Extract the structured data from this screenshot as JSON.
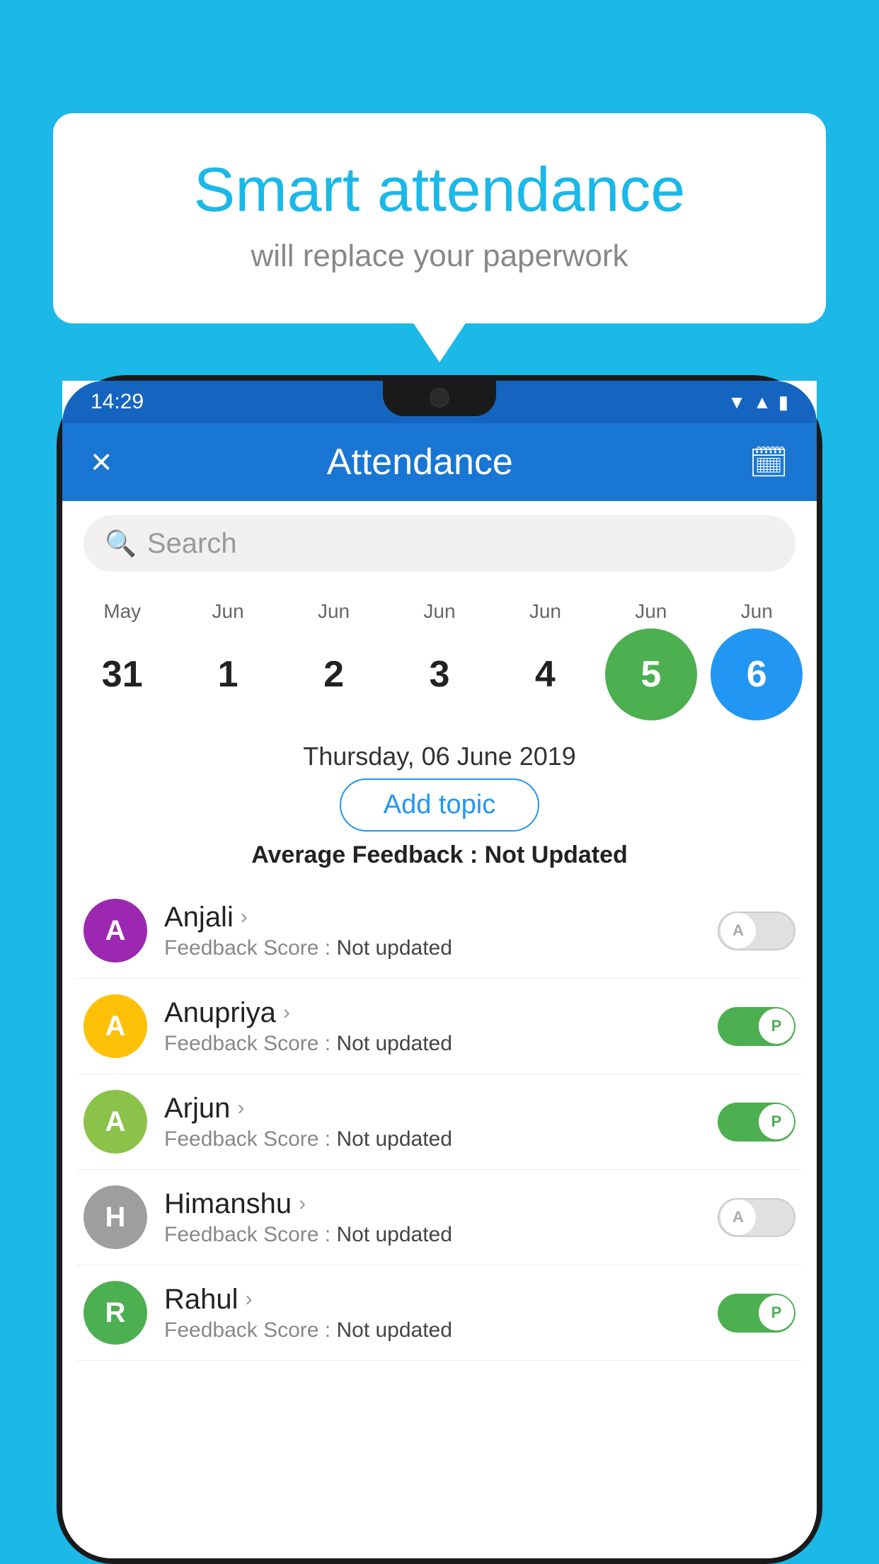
{
  "background_color": "#1BB8E8",
  "bubble": {
    "title": "Smart attendance",
    "subtitle": "will replace your paperwork"
  },
  "status_bar": {
    "time": "14:29",
    "wifi": "▼",
    "signal": "▲",
    "battery": "▪"
  },
  "app_bar": {
    "close_label": "×",
    "title": "Attendance",
    "calendar_icon": "📅"
  },
  "search": {
    "placeholder": "Search"
  },
  "calendar": {
    "months": [
      "May",
      "Jun",
      "Jun",
      "Jun",
      "Jun",
      "Jun",
      "Jun"
    ],
    "dates": [
      "31",
      "1",
      "2",
      "3",
      "4",
      "5",
      "6"
    ],
    "selected_green_index": 5,
    "selected_blue_index": 6
  },
  "selected_date": {
    "label": "Thursday, 06 June 2019"
  },
  "add_topic_btn": "Add topic",
  "avg_feedback": {
    "label": "Average Feedback : ",
    "value": "Not Updated"
  },
  "students": [
    {
      "name": "Anjali",
      "avatar_letter": "A",
      "avatar_color": "#9C27B0",
      "feedback_label": "Feedback Score : ",
      "feedback_value": "Not updated",
      "toggle": "off",
      "toggle_label": "A"
    },
    {
      "name": "Anupriya",
      "avatar_letter": "A",
      "avatar_color": "#FFC107",
      "feedback_label": "Feedback Score : ",
      "feedback_value": "Not updated",
      "toggle": "on",
      "toggle_label": "P"
    },
    {
      "name": "Arjun",
      "avatar_letter": "A",
      "avatar_color": "#8BC34A",
      "feedback_label": "Feedback Score : ",
      "feedback_value": "Not updated",
      "toggle": "on",
      "toggle_label": "P"
    },
    {
      "name": "Himanshu",
      "avatar_letter": "H",
      "avatar_color": "#9E9E9E",
      "feedback_label": "Feedback Score : ",
      "feedback_value": "Not updated",
      "toggle": "off",
      "toggle_label": "A"
    },
    {
      "name": "Rahul",
      "avatar_letter": "R",
      "avatar_color": "#4CAF50",
      "feedback_label": "Feedback Score : ",
      "feedback_value": "Not updated",
      "toggle": "on",
      "toggle_label": "P"
    }
  ]
}
